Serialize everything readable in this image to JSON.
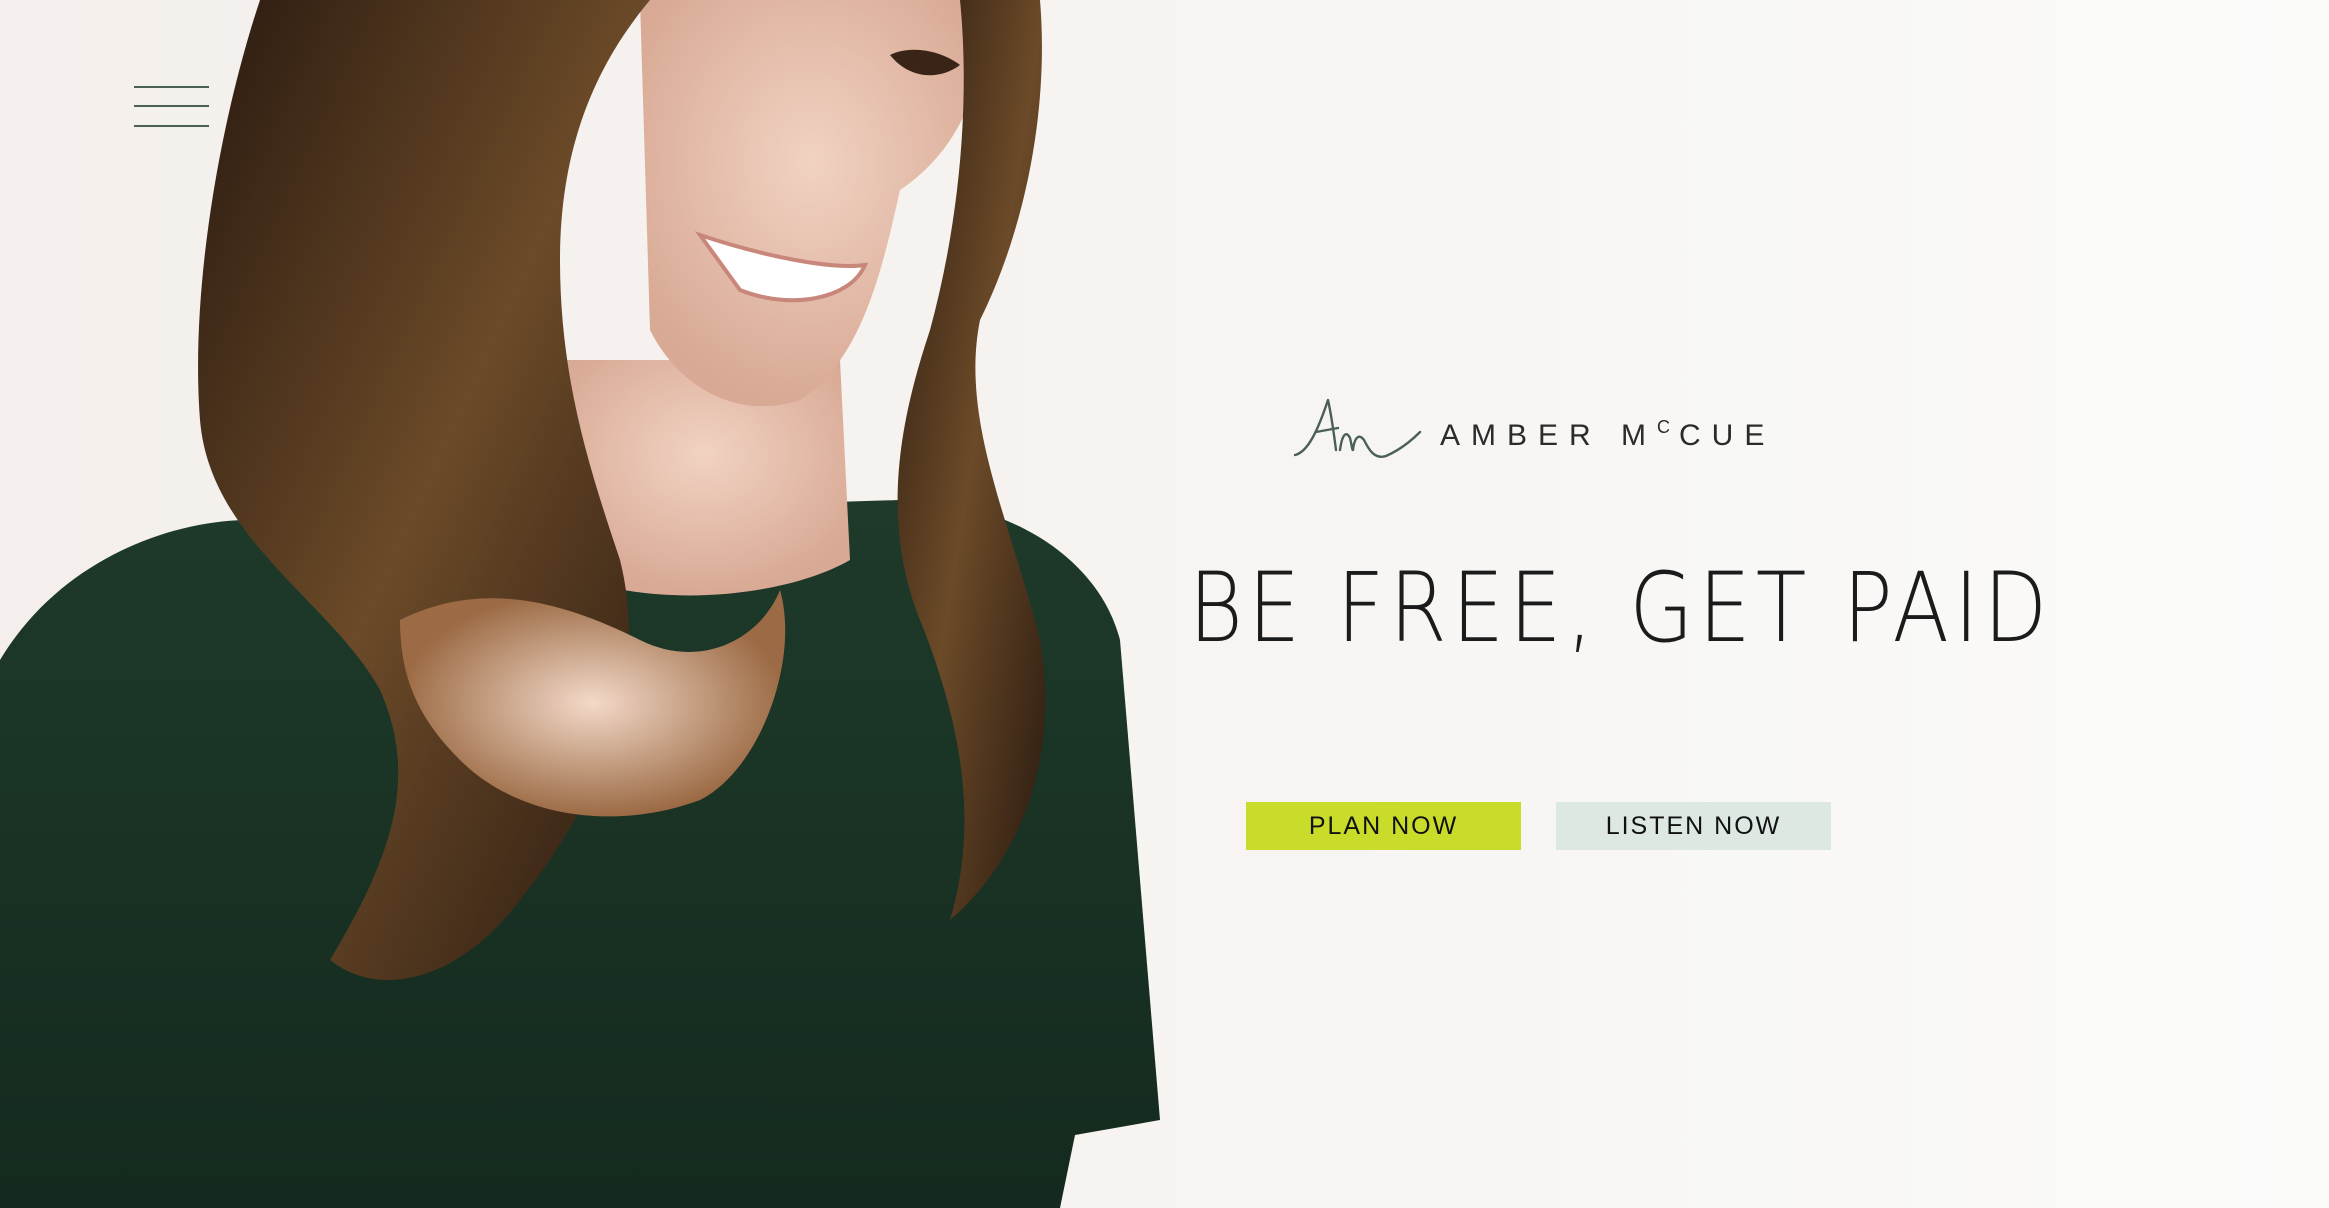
{
  "colors": {
    "accent": "#c9dc2a",
    "secondary_button": "#dde8e2",
    "menu_lines": "#4a5f56",
    "text": "#1b1b1b"
  },
  "hero": {
    "image": "portrait-photo"
  },
  "nav": {
    "menu_icon": "hamburger-menu-icon"
  },
  "brand": {
    "monogram": "Am",
    "name_main": "AMBER M",
    "name_super": "C",
    "name_tail": "CUE"
  },
  "headline": "BE FREE, GET PAID",
  "buttons": {
    "plan": "PLAN NOW",
    "listen": "LISTEN NOW"
  }
}
